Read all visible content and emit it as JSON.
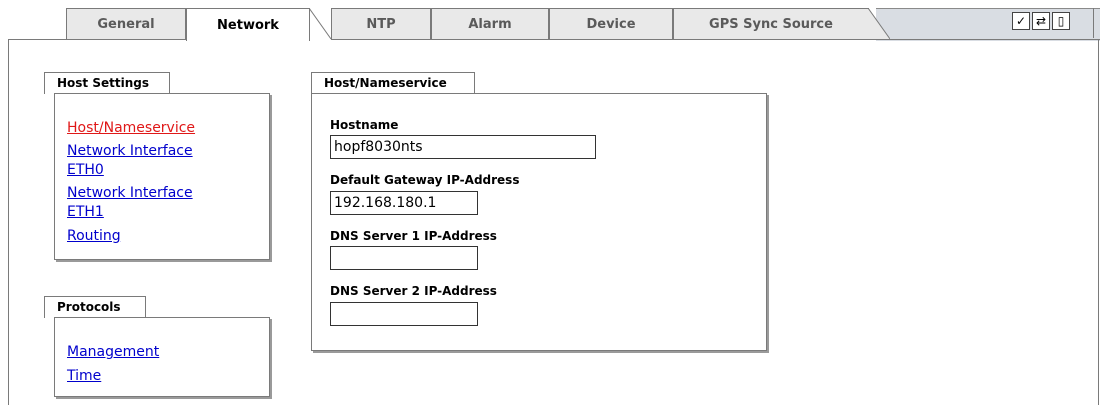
{
  "tabs": [
    {
      "label": "General",
      "active": false
    },
    {
      "label": "Network",
      "active": true
    },
    {
      "label": "NTP",
      "active": false
    },
    {
      "label": "Alarm",
      "active": false
    },
    {
      "label": "Device",
      "active": false
    },
    {
      "label": "GPS Sync Source",
      "active": false
    }
  ],
  "toolbar": {
    "icons": [
      "checkmark-icon",
      "refresh-icon",
      "page-icon"
    ]
  },
  "host_settings": {
    "title": "Host Settings",
    "links": [
      {
        "label": "Host/Nameservice",
        "active": true
      },
      {
        "label": "Network Interface",
        "label2": "ETH0",
        "active": false
      },
      {
        "label": "Network Interface",
        "label2": "ETH1",
        "active": false
      },
      {
        "label": "Routing",
        "active": false
      }
    ]
  },
  "protocols": {
    "title": "Protocols",
    "links": [
      {
        "label": "Management"
      },
      {
        "label": "Time"
      }
    ]
  },
  "host_nameservice": {
    "title": "Host/Nameservice",
    "hostname_label": "Hostname",
    "hostname_value": "hopf8030nts",
    "gateway_label": "Default Gateway IP-Address",
    "gateway_value": "192.168.180.1",
    "dns1_label": "DNS Server 1 IP-Address",
    "dns1_value": "",
    "dns2_label": "DNS Server 2 IP-Address",
    "dns2_value": ""
  },
  "colors": {
    "link": "#0000cc",
    "active_link": "#e01818",
    "tab_inactive_text": "#5a5a5a"
  }
}
